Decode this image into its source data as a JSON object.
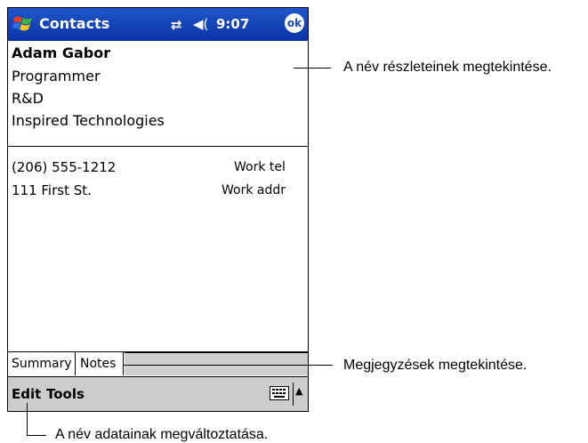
{
  "titlebar": {
    "app_title": "Contacts",
    "connectivity_glyph": "⇄",
    "speaker_glyph": "◀(",
    "time": "9:07",
    "ok_label": "ok"
  },
  "contact": {
    "name": "Adam Gabor",
    "job_title": "Programmer",
    "department": "R&D",
    "company": "Inspired Technologies"
  },
  "details": [
    {
      "value": "(206) 555-1212",
      "label": "Work tel"
    },
    {
      "value": "111 First St.",
      "label": "Work addr"
    }
  ],
  "tabs": [
    {
      "label": "Summary",
      "active": true
    },
    {
      "label": "Notes",
      "active": false
    }
  ],
  "menubar": {
    "edit_label": "Edit",
    "tools_label": "Tools",
    "sip_arrow": "▲"
  },
  "callouts": {
    "name_details": "A név részleteinek megtekintése.",
    "notes": "Megjegyzések megtekintése.",
    "edit": "A név adatainak megváltoztatása."
  },
  "icons": [
    "windows-start-icon",
    "connectivity-icon",
    "speaker-icon",
    "ok-icon",
    "keyboard-icon",
    "sip-arrow-icon"
  ],
  "colors": {
    "titlebar": "#0a33a8",
    "menubar": "#cdcdcd"
  }
}
